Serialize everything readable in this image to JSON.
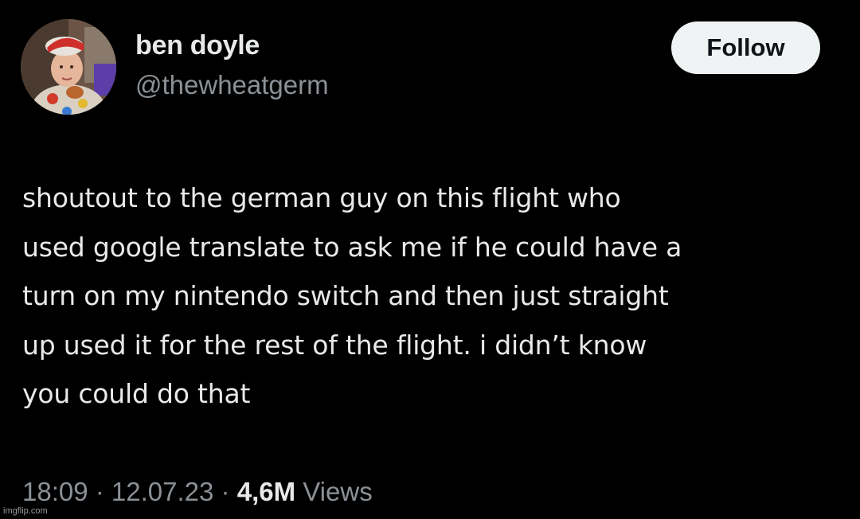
{
  "author": {
    "display_name": "ben doyle",
    "handle": "@thewheatgerm"
  },
  "follow_button": {
    "label": "Follow"
  },
  "tweet": {
    "lines": [
      "shoutout to the german guy on this flight who",
      "used google translate to ask me if he could have a",
      "turn on my nintendo switch and then just straight",
      "up used it for the rest of the flight. i didn’t know",
      "you could do that"
    ]
  },
  "meta": {
    "time": "18:09",
    "separator_1": " · ",
    "date": "12.07.23",
    "separator_2": " · ",
    "views_count": "4,6M",
    "views_label": " Views"
  },
  "watermark": {
    "text": "imgflip.com"
  },
  "colors": {
    "background": "#000000",
    "primary_text": "#e7e9ea",
    "secondary_text": "#8b9196",
    "follow_button_bg": "#eff3f4",
    "follow_button_text": "#0f1419"
  },
  "icons": {
    "avatar": "profile-photo-toddler"
  }
}
